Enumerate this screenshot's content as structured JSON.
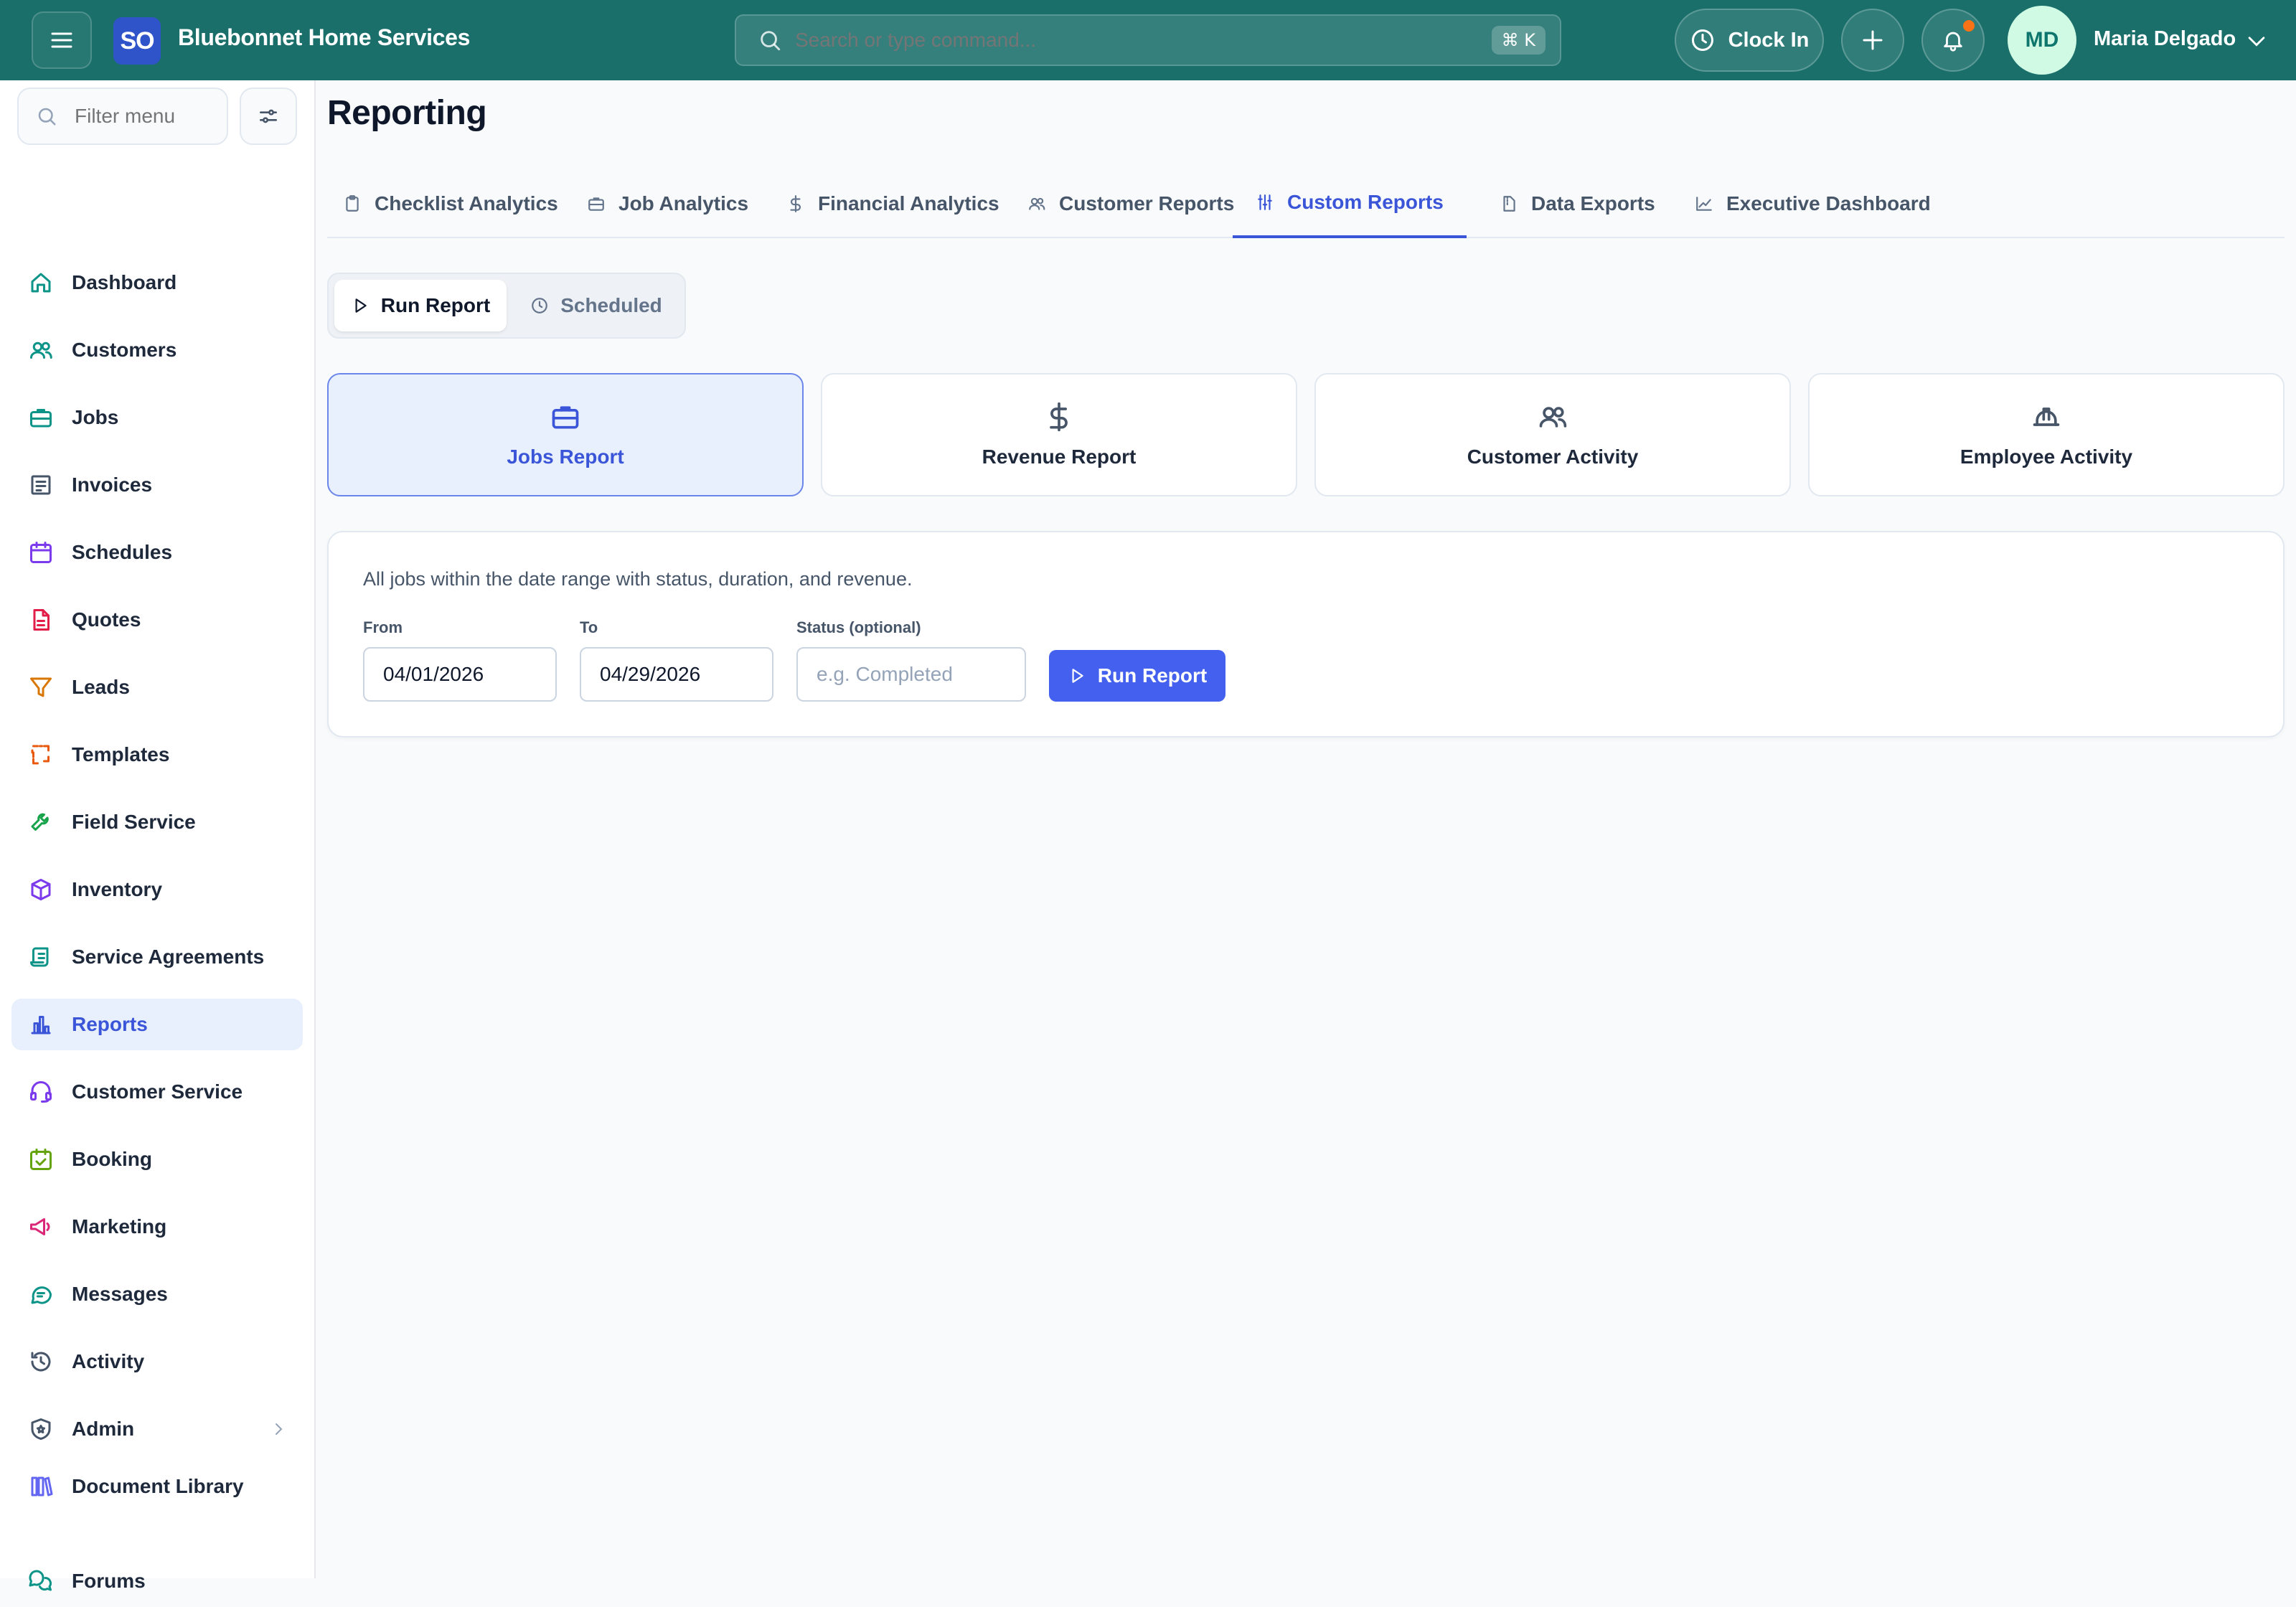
{
  "header": {
    "logo_text": "SO",
    "brand": "Bluebonnet Home Services",
    "search_placeholder": "Search or type command...",
    "search_shortcut": "⌘ K",
    "clock_in_label": "Clock In",
    "user_initials": "MD",
    "user_name": "Maria Delgado",
    "has_notification": true
  },
  "sidebar": {
    "filter_placeholder": "Filter menu",
    "items": [
      {
        "label": "Dashboard",
        "icon": "home-icon",
        "color": "#0d9488"
      },
      {
        "label": "Customers",
        "icon": "users-icon",
        "color": "#0d9488"
      },
      {
        "label": "Jobs",
        "icon": "briefcase-icon",
        "color": "#0d9488"
      },
      {
        "label": "Invoices",
        "icon": "receipt-icon",
        "color": "#475569"
      },
      {
        "label": "Schedules",
        "icon": "calendar-icon",
        "color": "#7c3aed"
      },
      {
        "label": "Quotes",
        "icon": "file-text-icon",
        "color": "#e11d48"
      },
      {
        "label": "Leads",
        "icon": "funnel-icon",
        "color": "#d97706"
      },
      {
        "label": "Templates",
        "icon": "template-icon",
        "color": "#ea580c"
      },
      {
        "label": "Field Service",
        "icon": "wrench-icon",
        "color": "#16a34a"
      },
      {
        "label": "Inventory",
        "icon": "package-icon",
        "color": "#7c3aed"
      },
      {
        "label": "Service Agreements",
        "icon": "scroll-icon",
        "color": "#0d9488"
      },
      {
        "label": "Reports",
        "icon": "bar-chart-icon",
        "color": "#3b55d9",
        "active": true
      },
      {
        "label": "Customer Service",
        "icon": "headset-icon",
        "color": "#7c3aed"
      },
      {
        "label": "Booking",
        "icon": "calendar-check-icon",
        "color": "#65a30d"
      },
      {
        "label": "Marketing",
        "icon": "megaphone-icon",
        "color": "#db2777"
      },
      {
        "label": "Messages",
        "icon": "message-icon",
        "color": "#0d9488"
      },
      {
        "label": "Activity",
        "icon": "history-icon",
        "color": "#475569"
      },
      {
        "label": "Admin",
        "icon": "shield-icon",
        "color": "#475569",
        "expandable": true
      },
      {
        "label": "Document Library",
        "icon": "library-icon",
        "color": "#6366f1"
      },
      {
        "label": "Forums",
        "icon": "chat-bubbles-icon",
        "color": "#0d9488"
      }
    ]
  },
  "page": {
    "title": "Reporting",
    "tabs": [
      {
        "label": "Checklist Analytics",
        "icon": "clipboard-icon"
      },
      {
        "label": "Job Analytics",
        "icon": "briefcase-icon"
      },
      {
        "label": "Financial Analytics",
        "icon": "dollar-icon"
      },
      {
        "label": "Customer Reports",
        "icon": "users-icon"
      },
      {
        "label": "Custom Reports",
        "icon": "sliders-icon",
        "active": true
      },
      {
        "label": "Data Exports",
        "icon": "file-zip-icon"
      },
      {
        "label": "Executive Dashboard",
        "icon": "trend-chart-icon"
      }
    ],
    "mode_toggle": {
      "run_label": "Run Report",
      "scheduled_label": "Scheduled",
      "selected": "Run Report"
    },
    "report_types": [
      {
        "label": "Jobs Report",
        "icon": "briefcase-icon",
        "active": true
      },
      {
        "label": "Revenue Report",
        "icon": "dollar-icon"
      },
      {
        "label": "Customer Activity",
        "icon": "users-icon"
      },
      {
        "label": "Employee Activity",
        "icon": "hard-hat-icon"
      }
    ],
    "form": {
      "description": "All jobs within the date range with status, duration, and revenue.",
      "from_label": "From",
      "from_value": "04/01/2026",
      "to_label": "To",
      "to_value": "04/29/2026",
      "status_label": "Status (optional)",
      "status_placeholder": "e.g. Completed",
      "run_label": "Run Report"
    }
  },
  "colors": {
    "header_bg": "#1a6f6b",
    "accent": "#3b55d9",
    "button": "#4361ee",
    "notification_dot": "#f97316"
  }
}
